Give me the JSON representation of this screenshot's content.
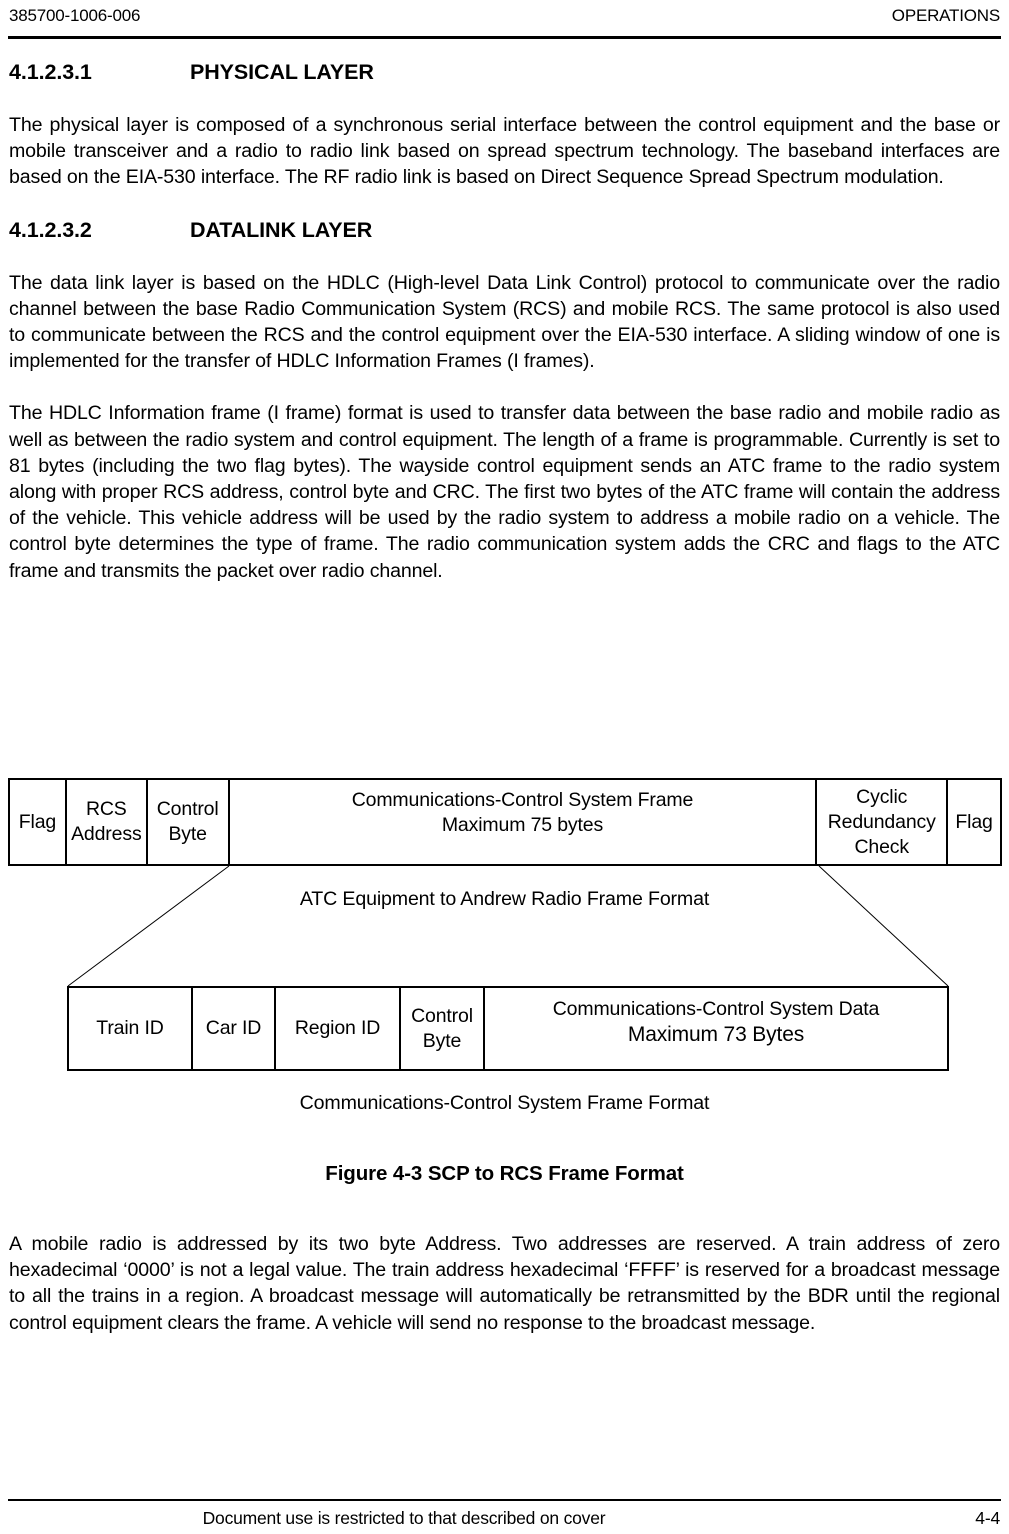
{
  "header": {
    "doc_number": "385700-1006-006",
    "title": "OPERATIONS"
  },
  "sections": [
    {
      "number": "4.1.2.3.1",
      "heading": "PHYSICAL LAYER",
      "paragraphs": [
        "The physical layer is composed of a synchronous serial interface between the control equipment and the base or mobile transceiver and a radio to radio link based on spread spectrum technology.  The baseband interfaces are based on the EIA-530 interface.  The RF radio link is based on Direct Sequence Spread Spectrum modulation."
      ]
    },
    {
      "number": "4.1.2.3.2",
      "heading": "DATALINK LAYER",
      "paragraphs": [
        "The data link layer is based on the HDLC (High-level Data Link Control) protocol to communicate over the radio channel between the base Radio Communication System (RCS) and mobile RCS. The same protocol is also used to communicate between the RCS and the control equipment over the EIA-530 interface. A sliding window of one is implemented for the transfer of HDLC Information Frames (I frames).",
        "The HDLC Information frame (I frame) format is used to transfer data between the base radio and mobile radio as well as between the radio system and control equipment.  The  length of a frame is programmable.  Currently is set to 81 bytes (including the two flag bytes). The wayside control equipment sends an ATC frame to the radio system along with proper RCS address, control byte and CRC.  The first two bytes of the ATC frame will contain the address of the vehicle. This vehicle address will be used by the radio system to address a mobile radio on a vehicle. The control byte determines the type of frame.  The radio communication system adds the CRC and flags to the ATC frame and transmits the packet over radio channel."
      ]
    }
  ],
  "figure": {
    "title": "Figure 4-3  SCP to RCS Frame Format",
    "top_table": {
      "caption": "ATC Equipment to Andrew Radio Frame Format",
      "cells": [
        {
          "line1": "Flag",
          "line2": ""
        },
        {
          "line1": "RCS",
          "line2": "Address"
        },
        {
          "line1": "Control",
          "line2": "Byte"
        },
        {
          "line1": "Communications-Control System Frame",
          "line2": "Maximum 75 bytes"
        },
        {
          "line1": "Cyclic",
          "line2": "Redundancy",
          "line3": "Check"
        },
        {
          "line1": "Flag",
          "line2": ""
        }
      ]
    },
    "bottom_table": {
      "caption": "Communications-Control System Frame Format",
      "cells": [
        {
          "line1": "Train ID",
          "line2": ""
        },
        {
          "line1": "Car ID",
          "line2": ""
        },
        {
          "line1": "Region ID",
          "line2": ""
        },
        {
          "line1": "Control",
          "line2": "Byte"
        },
        {
          "line1": "Communications-Control System Data",
          "line2": "Maximum 73 Bytes"
        }
      ]
    }
  },
  "closing_paragraph": "A mobile radio is addressed by its two byte Address.  Two addresses are reserved. A train address of zero hexadecimal ‘0000’ is not a legal value. The train address hexadecimal ‘FFFF’ is reserved for a broadcast message to all the trains in a region.  A broadcast message will automatically be retransmitted by the BDR until the regional control equipment clears the frame.  A vehicle will send no response to the broadcast message.",
  "footer": {
    "notice": "Document use is restricted to that described on cover",
    "page_number": "4-4"
  }
}
